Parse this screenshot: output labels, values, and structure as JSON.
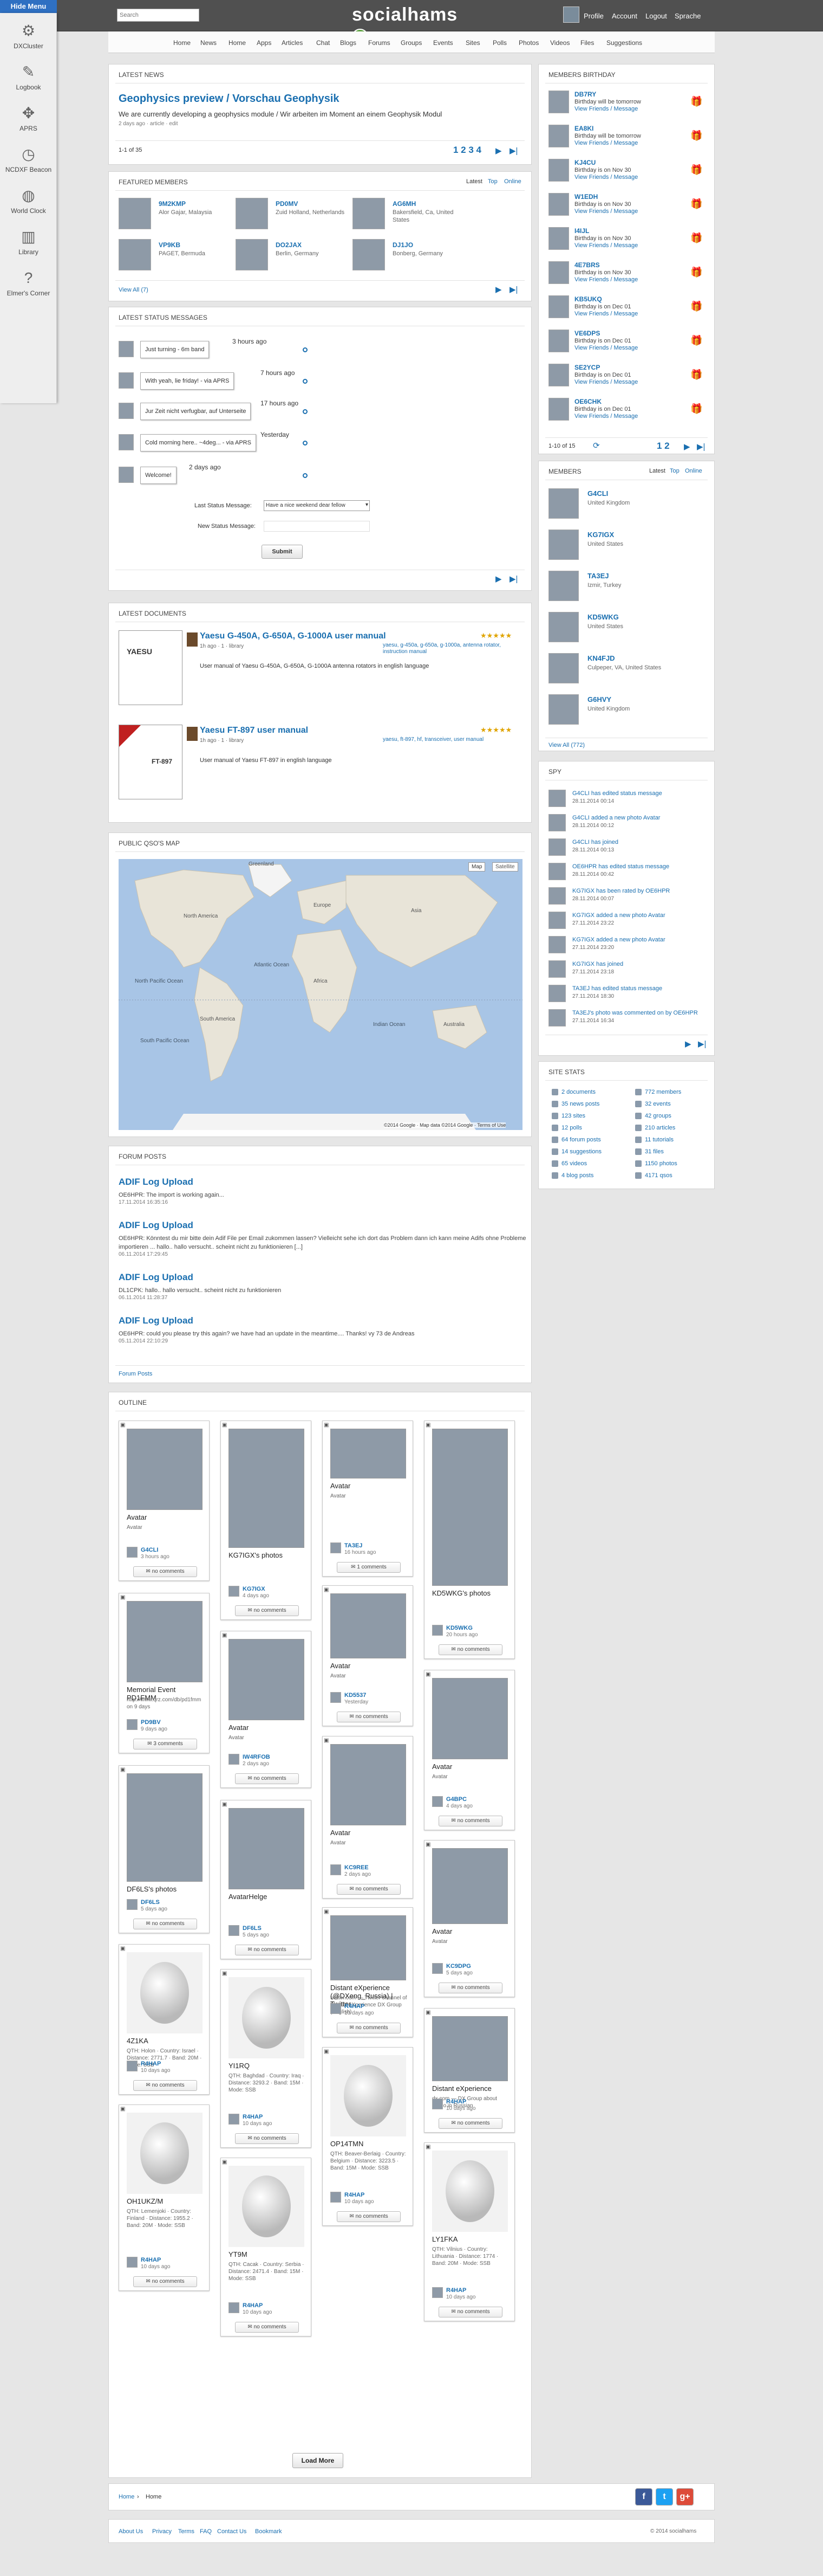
{
  "topbar": {
    "hide_menu": "Hide Menu",
    "search_placeholder": "Search",
    "logo": "socialhams",
    "links": [
      "Profile",
      "Account",
      "Logout",
      "Sprache"
    ]
  },
  "side_menu": [
    {
      "icon": "settings-icon",
      "label": "DXCluster"
    },
    {
      "icon": "edit-icon",
      "label": "Logbook"
    },
    {
      "icon": "move-icon",
      "label": "APRS"
    },
    {
      "icon": "clock-icon",
      "label": "NCDXF Beacon"
    },
    {
      "icon": "globe-icon",
      "label": "World Clock"
    },
    {
      "icon": "books-icon",
      "label": "Library"
    },
    {
      "icon": "help-icon",
      "label": "Elmer's Corner"
    }
  ],
  "nav": [
    "Home",
    "News",
    "Home",
    "Apps",
    "Articles",
    "Chat",
    "Blogs",
    "Forums",
    "Groups",
    "Events",
    "Sites",
    "Polls",
    "Photos",
    "Videos",
    "Files",
    "Suggestions"
  ],
  "latest_news": {
    "header": "LATEST NEWS",
    "title": "Geophysics preview / Vorschau Geophysik",
    "text": "We are currently developing a geophysics module / Wir arbeiten im Moment an einem Geophysik Modul",
    "meta": "2 days ago · article · edit",
    "count": "1-1 of 35",
    "pages": "1 2 3 4"
  },
  "featured_members": {
    "header": "FEATURED MEMBERS",
    "tabs": [
      "Latest",
      "Top",
      "Online"
    ],
    "members": [
      {
        "call": "9M2KMP",
        "loc": "Alor Gajar, Malaysia"
      },
      {
        "call": "PD0MV",
        "loc": "Zuid Holland, Netherlands"
      },
      {
        "call": "AG6MH",
        "loc": "Bakersfield, Ca, United States"
      },
      {
        "call": "VP9KB",
        "loc": "PAGET, Bermuda"
      },
      {
        "call": "DO2JAX",
        "loc": "Berlin, Germany"
      },
      {
        "call": "DJ1JO",
        "loc": "Bonberg, Germany"
      }
    ],
    "view_all": "View All (7)"
  },
  "status_messages": {
    "header": "LATEST STATUS MESSAGES",
    "items": [
      {
        "text": "Just turning - 6m band",
        "when": "3 hours ago"
      },
      {
        "text": "With yeah, lie friday! - via APRS",
        "when": "7 hours ago"
      },
      {
        "text": "Jur Zeit nicht verfugbar, auf Unterseite",
        "when": "17 hours ago"
      },
      {
        "text": "Cold morning here.. ~4deg... - via APRS",
        "when": "Yesterday"
      },
      {
        "text": "Welcome!",
        "when": "2 days ago"
      }
    ],
    "last_label": "Last Status Message:",
    "last_value": "Have a nice weekend dear fellow",
    "new_label": "New Status Message:",
    "submit": "Submit"
  },
  "documents": {
    "header": "LATEST DOCUMENTS",
    "items": [
      {
        "title": "Yaesu G-450A, G-650A, G-1000A user manual",
        "sub": "1h ago · 1 · library",
        "meta": "yaesu, g-450a, g-650a, g-1000a, antenna rotator, instruction manual",
        "desc": "User manual of Yaesu G-450A, G-650A, G-1000A antenna rotators in english language",
        "thumb_label": "YAESU"
      },
      {
        "title": "Yaesu FT-897 user manual",
        "sub": "1h ago · 1 · library",
        "meta": "yaesu, ft-897, hf, transceiver, user manual",
        "desc": "User manual of Yaesu FT-897 in english language",
        "thumb_label": "FT-897"
      }
    ]
  },
  "map": {
    "header": "PUBLIC QSO'S MAP",
    "btn_map": "Map",
    "btn_sat": "Satellite",
    "footer": "©2014 Google · Map data ©2014 Google · Terms of Use",
    "labels": [
      "North America",
      "South America",
      "Africa",
      "Europe",
      "Asia",
      "Australia",
      "North Pacific Ocean",
      "South Pacific Ocean",
      "Atlantic Ocean",
      "Indian Ocean",
      "Greenland"
    ]
  },
  "forum_posts": {
    "header": "FORUM POSTS",
    "items": [
      {
        "title": "ADIF Log Upload",
        "text": "OE6HPR: The import is working again...",
        "date": "17.11.2014 16:35:16"
      },
      {
        "title": "ADIF Log Upload",
        "text": "OE6HPR: Könntest du mir bitte dein Adif File per Email zukommen lassen? Vielleicht sehe ich dort das Problem dann ich kann meine Adifs ohne Probleme importieren ... hallo.. hallo versucht.. scheint nicht zu funktionieren [...]",
        "date": "06.11.2014 17:29:45"
      },
      {
        "title": "ADIF Log Upload",
        "text": "DL1CPK: hallo.. hallo versucht.. scheint nicht zu funktionieren",
        "date": "06.11.2014 11:28:37"
      },
      {
        "title": "ADIF Log Upload",
        "text": "OE6HPR: could you please try this again? we have had an update in the meantime.... Thanks!   vy 73 de Andreas",
        "date": "05.11.2014 22:10:29"
      }
    ],
    "footer": "Forum Posts"
  },
  "birthdays": {
    "header": "MEMBERS BIRTHDAY",
    "items": [
      {
        "call": "DB7RY",
        "when": "Birthday will be tomorrow"
      },
      {
        "call": "EA8KI",
        "when": "Birthday will be tomorrow"
      },
      {
        "call": "KJ4CU",
        "when": "Birthday is on Nov 30"
      },
      {
        "call": "W1EDH",
        "when": "Birthday is on Nov 30"
      },
      {
        "call": "I4IJL",
        "when": "Birthday is on Nov 30"
      },
      {
        "call": "4E7BRS",
        "when": "Birthday is on Nov 30"
      },
      {
        "call": "KB5UKQ",
        "when": "Birthday is on Dec 01"
      },
      {
        "call": "VE6DPS",
        "when": "Birthday is on Dec 01"
      },
      {
        "call": "SE2YCP",
        "when": "Birthday is on Dec 01"
      },
      {
        "call": "OE6CHK",
        "when": "Birthday is on Dec 01"
      }
    ],
    "links": "View Friends / Message",
    "count": "1-10 of 15",
    "pages": "1 2"
  },
  "members": {
    "header": "MEMBERS",
    "tabs": [
      "Latest",
      "Top",
      "Online"
    ],
    "items": [
      {
        "call": "G4CLI",
        "loc": "United Kingdom"
      },
      {
        "call": "KG7IGX",
        "loc": "United States"
      },
      {
        "call": "TA3EJ",
        "loc": "Izmir, Turkey"
      },
      {
        "call": "KD5WKG",
        "loc": "United States"
      },
      {
        "call": "KN4FJD",
        "loc": "Culpeper, VA, United States"
      },
      {
        "call": "G6HVY",
        "loc": "United Kingdom"
      }
    ],
    "view_all": "View All (772)"
  },
  "spy": {
    "header": "SPY",
    "items": [
      {
        "text": "G4CLI has edited status message",
        "date": "28.11.2014 00:14"
      },
      {
        "text": "G4CLI added a new photo Avatar",
        "date": "28.11.2014 00:12"
      },
      {
        "text": "G4CLI has joined",
        "date": "28.11.2014 00:13"
      },
      {
        "text": "OE6HPR has edited status message",
        "date": "28.11.2014 00:42"
      },
      {
        "text": "KG7IGX has been rated by OE6HPR",
        "date": "28.11.2014 00:07"
      },
      {
        "text": "KG7IGX added a new photo Avatar",
        "date": "27.11.2014 23:22"
      },
      {
        "text": "KG7IGX added a new photo Avatar",
        "date": "27.11.2014 23:20"
      },
      {
        "text": "KG7IGX has joined",
        "date": "27.11.2014 23:18"
      },
      {
        "text": "TA3EJ has edited status message",
        "date": "27.11.2014 18:30"
      },
      {
        "text": "TA3EJ's photo was commented on by OE6HPR",
        "date": "27.11.2014 16:34"
      }
    ]
  },
  "site_stats": {
    "header": "SITE STATS",
    "items": [
      "2 documents",
      "772 members",
      "35 news posts",
      "32 events",
      "123 sites",
      "42 groups",
      "12 polls",
      "210 articles",
      "64 forum posts",
      "11 tutorials",
      "14 suggestions",
      "31 files",
      "65 videos",
      "1150 photos",
      "4 blog posts",
      "4171 qsos"
    ]
  },
  "outline": {
    "header": "OUTLINE",
    "cards": [
      {
        "title": "Avatar",
        "sub": "Avatar",
        "call": "G4CLI",
        "ago": "3 hours ago",
        "btn": "no comments"
      },
      {
        "title": "KG7IGX's photos",
        "sub": "",
        "call": "KG7IGX",
        "ago": "4 days ago",
        "btn": "no comments"
      },
      {
        "title": "Avatar",
        "sub": "Avatar",
        "call": "TA3EJ",
        "ago": "16 hours ago",
        "btn": "1 comments"
      },
      {
        "title": "KD5WKG's photos",
        "sub": "",
        "call": "KD5WKG",
        "ago": "20 hours ago",
        "btn": "no comments"
      },
      {
        "title": "Memorial Event PD1FMM",
        "sub": "http://www.qrz.com/db/pd1fmm on 9 days",
        "call": "PD9BV",
        "ago": "9 days ago",
        "btn": "3 comments"
      },
      {
        "title": "Avatar",
        "sub": "Avatar",
        "call": "KD5537",
        "ago": "Yesterday",
        "btn": "no comments"
      },
      {
        "title": "Avatar",
        "sub": "Avatar",
        "call": "IW4RFOB",
        "ago": "2 days ago",
        "btn": "no comments"
      },
      {
        "title": "Avatar",
        "sub": "Avatar",
        "call": "G4BPC",
        "ago": "4 days ago",
        "btn": "no comments"
      },
      {
        "title": "DF6LS's photos",
        "sub": "",
        "call": "DF6LS",
        "ago": "5 days ago",
        "btn": "no comments"
      },
      {
        "title": "Avatar",
        "sub": "Avatar",
        "call": "KC9REE",
        "ago": "2 days ago",
        "btn": "no comments"
      },
      {
        "title": "AvatarHelge",
        "sub": "",
        "call": "DF6LS",
        "ago": "5 days ago",
        "btn": "no comments"
      },
      {
        "title": "Avatar",
        "sub": "Avatar",
        "call": "KC9DPG",
        "ago": "5 days ago",
        "btn": "no comments"
      },
      {
        "title": "YI1RQ",
        "sub": "QTH: Baghdad · Country: Iraq · Distance: 3293.2 · Band: 15M · Mode: SSB",
        "call": "R4HAP",
        "ago": "10 days ago",
        "btn": "no comments"
      },
      {
        "title": "Distant eXperience (@DXeng_Russia) | Twitter",
        "sub": "twitter.com — Twitter channel of Distant eXperience DX Group (English)",
        "call": "R4HAP",
        "ago": "10 days ago",
        "btn": "no comments"
      },
      {
        "title": "Distant eXperience",
        "sub": "dx.com — DX Group about Radio in Russian",
        "call": "R4HAP",
        "ago": "10 days ago",
        "btn": "no comments"
      },
      {
        "title": "4Z1KA",
        "sub": "QTH: Holon · Country: Israel · Distance: 2771.7 · Band: 20M · Mode: SSB",
        "call": "R4HAP",
        "ago": "10 days ago",
        "btn": "no comments"
      },
      {
        "title": "YT9M",
        "sub": "QTH: Cacak · Country: Serbia · Distance: 2471.4 · Band: 15M · Mode: SSB",
        "call": "R4HAP",
        "ago": "10 days ago",
        "btn": "no comments"
      },
      {
        "title": "OP14TMN",
        "sub": "QTH: Beaver-Berlaig · Country: Belgium · Distance: 3223.5 · Band: 15M · Mode: SSB",
        "call": "R4HAP",
        "ago": "10 days ago",
        "btn": "no comments"
      },
      {
        "title": "LY1FKA",
        "sub": "QTH: Vilnius · Country: Lithuania · Distance: 1774 · Band: 20M · Mode: SSB",
        "call": "R4HAP",
        "ago": "10 days ago",
        "btn": "no comments"
      },
      {
        "title": "OH1UKZ/M",
        "sub": "QTH: Lemenjoki · Country: Finland · Distance: 1955.2 · Band: 20M · Mode: SSB",
        "call": "R4HAP",
        "ago": "10 days ago",
        "btn": "no comments"
      }
    ],
    "load_more": "Load More"
  },
  "footer": {
    "breadcrumb": [
      "Home",
      "Home"
    ],
    "links": [
      "About Us",
      "Privacy",
      "Terms",
      "FAQ",
      "Contact Us",
      "Bookmark"
    ],
    "copyright": "© 2014 socialhams",
    "social": [
      "f",
      "t",
      "g+"
    ]
  }
}
